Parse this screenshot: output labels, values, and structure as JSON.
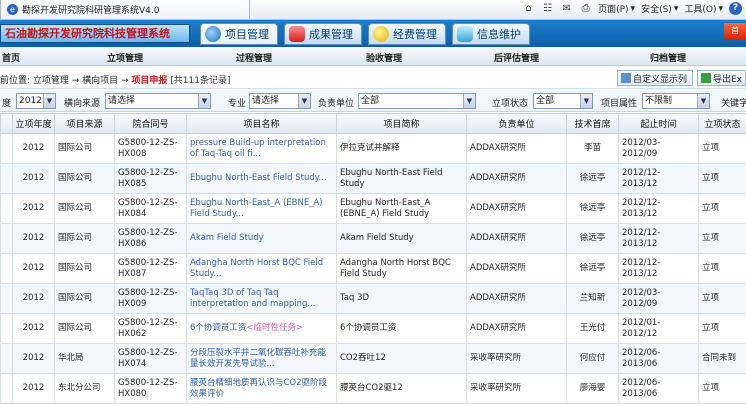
{
  "browser": {
    "tab_title": "勘探开发研究院科研管理系统V4.0",
    "tools": {
      "page": "页面(P)",
      "safety": "安全(S)",
      "tools": "工具(O)"
    }
  },
  "app": {
    "title": "石油勘探开发研究院科技管理系统",
    "corner": "首"
  },
  "modules": [
    {
      "label": "项目管理",
      "icon": "globe-icon",
      "active": true
    },
    {
      "label": "成果管理",
      "icon": "award-icon",
      "active": false
    },
    {
      "label": "经费管理",
      "icon": "coin-icon",
      "active": false
    },
    {
      "label": "信息维护",
      "icon": "monitor-icon",
      "active": false
    }
  ],
  "subnav": [
    "首页",
    "立项管理",
    "过程管理",
    "验收管理",
    "后评估管理",
    "归档管理"
  ],
  "breadcrumb": {
    "prefix": "前位置: 立项管理 → 横向项目 → ",
    "current": "项目申报",
    "count": " [共111条记录]",
    "custom_btn": "自定义显示列",
    "export_btn": "导出Ex"
  },
  "filter": {
    "year_label": "度",
    "year_value": "2012",
    "source_label": "横向来源",
    "source_value": "请选择",
    "major_label": "专业",
    "major_value": "请选择",
    "unit_label": "负责单位",
    "unit_value": "全部",
    "status_label": "立项状态",
    "status_value": "全部",
    "attr_label": "项目属性",
    "attr_value": "不限制",
    "keyword_label": "关键字"
  },
  "table": {
    "columns": [
      "",
      "立项年度",
      "项目来源",
      "院合同号",
      "项目名称",
      "项目简称",
      "负责单位",
      "技术首席",
      "起止时间",
      "立项状态"
    ],
    "rows": [
      {
        "year": "2012",
        "source": "国际公司",
        "contract": "G5800-12-ZS-HX008",
        "name": "pressure Build-up interpretation of Taq-Taq oil fi...",
        "tag": "",
        "short": "伊拉克试井解释",
        "unit": "ADDAX研究所",
        "chief": "李苗",
        "period": "2012/03-2012/09",
        "status": "立项"
      },
      {
        "year": "2012",
        "source": "国际公司",
        "contract": "G5800-12-ZS-HX085",
        "name": "Ebughu North-East Field Study...",
        "tag": "",
        "short": "Ebughu North-East Field Study",
        "unit": "ADDAX研究所",
        "chief": "徐远亭",
        "period": "2012/12-2013/12",
        "status": "立项"
      },
      {
        "year": "2012",
        "source": "国际公司",
        "contract": "G5800-12-ZS-HX084",
        "name": "Ebughu North-East_A (EBNE_A) Field Study...",
        "tag": "",
        "short": "Ebughu North-East_A (EBNE_A) Field Study",
        "unit": "ADDAX研究所",
        "chief": "徐远亭",
        "period": "2012/12-2013/12",
        "status": "立项"
      },
      {
        "year": "2012",
        "source": "国际公司",
        "contract": "G5800-12-ZS-HX086",
        "name": "Akam Field Study",
        "tag": "",
        "short": "Akam Field Study",
        "unit": "ADDAX研究所",
        "chief": "徐远亭",
        "period": "2012/12-2013/12",
        "status": "立项"
      },
      {
        "year": "2012",
        "source": "国际公司",
        "contract": "G5800-12-ZS-HX087",
        "name": "Adangha North Horst BQC Field Study...",
        "tag": "",
        "short": "Adangha North Horst BQC Field Study",
        "unit": "ADDAX研究所",
        "chief": "徐远亭",
        "period": "2012/12-2013/12",
        "status": "立项"
      },
      {
        "year": "2012",
        "source": "国际公司",
        "contract": "G5800-12-ZS-HX009",
        "name": "TaqTaq 3D of Taq Taq interpretation and mapping...",
        "tag": "",
        "short": "Taq 3D",
        "unit": "ADDAX研究所",
        "chief": "兰知新",
        "period": "2012/03-2012/09",
        "status": "立项"
      },
      {
        "year": "2012",
        "source": "国际公司",
        "contract": "G5800-12-ZS-HX062",
        "name": "6个协调员工资",
        "tag": "<临时性任务>",
        "short": "6个协调员工资",
        "unit": "ADDAX研究所",
        "chief": "王光付",
        "period": "2012/01-2012/12",
        "status": "立项"
      },
      {
        "year": "2012",
        "source": "华北局",
        "contract": "G5800-12-ZS-HX074",
        "name": "分段压裂水平井二氧化碳吞吐补充能量长效开发先导试验...",
        "tag": "",
        "short": "CO2吞吐12",
        "unit": "采收率研究所",
        "chief": "何应付",
        "period": "2012/06-2013/06",
        "status": "合同未到"
      },
      {
        "year": "2012",
        "source": "东北分公司",
        "contract": "G5800-12-ZS-HX080",
        "name": "腰英台精细地质再认识与CO2驱阶段效果评价",
        "tag": "",
        "short": "腰英台CO2驱12",
        "unit": "采收率研究所",
        "chief": "廖海婴",
        "period": "2012/06-2013/06",
        "status": "立项"
      }
    ]
  }
}
